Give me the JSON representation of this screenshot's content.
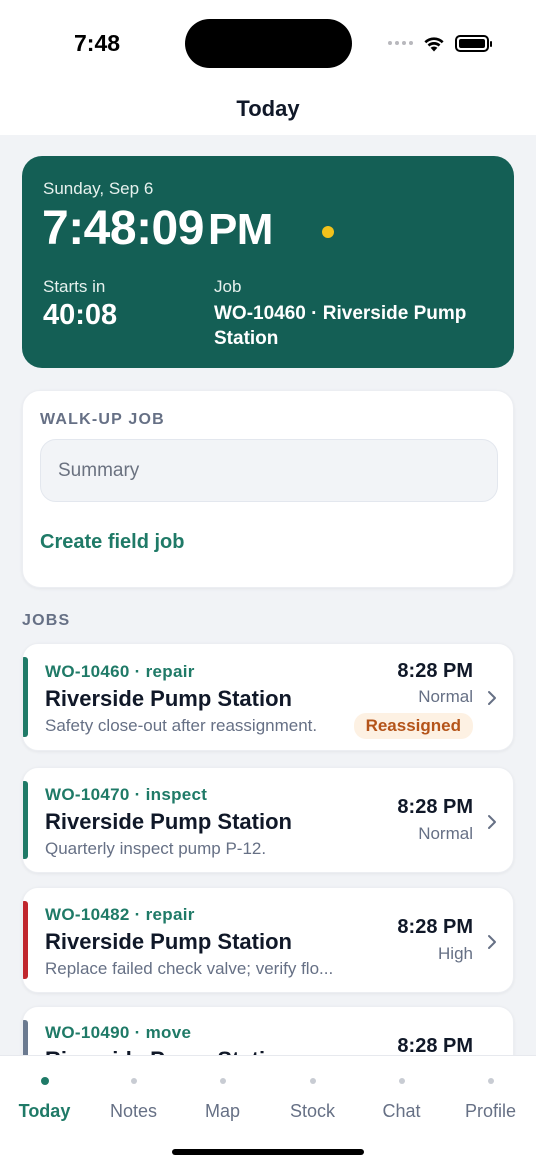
{
  "status_bar": {
    "time": "7:48"
  },
  "header": {
    "title": "Today"
  },
  "hero": {
    "date": "Sunday, Sep 6",
    "clock": "7:48:09",
    "ampm": "PM",
    "starts_label": "Starts in",
    "starts_value": "40:08",
    "job_label": "Job",
    "job_value": "WO-10460 · Riverside Pump Station",
    "colors": {
      "background": "#145f55",
      "live_dot": "#f2c21b"
    }
  },
  "walkup": {
    "label": "WALK-UP JOB",
    "summary_placeholder": "Summary",
    "summary_value": "",
    "create_label": "Create field job"
  },
  "jobs": {
    "label": "JOBS",
    "items": [
      {
        "code": "WO-10460 · repair",
        "title": "Riverside Pump Station",
        "description": "Safety close-out after reassignment.",
        "time": "8:28 PM",
        "priority": "Normal",
        "badge": "Reassigned",
        "stripe_color": "#1f7a67"
      },
      {
        "code": "WO-10470 · inspect",
        "title": "Riverside Pump Station",
        "description": "Quarterly inspect pump P-12.",
        "time": "8:28 PM",
        "priority": "Normal",
        "badge": "",
        "stripe_color": "#1f7a67"
      },
      {
        "code": "WO-10482 · repair",
        "title": "Riverside Pump Station",
        "description": "Replace failed check valve; verify flo...",
        "time": "8:28 PM",
        "priority": "High",
        "badge": "",
        "stripe_color": "#c0262d"
      },
      {
        "code": "WO-10490 · move",
        "title": "Riverside Pump Station",
        "description": "",
        "time": "8:28 PM",
        "priority": "",
        "badge": "",
        "stripe_color": "#6b7a90"
      }
    ]
  },
  "tabs": [
    {
      "label": "Today",
      "active": true
    },
    {
      "label": "Notes",
      "active": false
    },
    {
      "label": "Map",
      "active": false
    },
    {
      "label": "Stock",
      "active": false
    },
    {
      "label": "Chat",
      "active": false
    },
    {
      "label": "Profile",
      "active": false
    }
  ],
  "theme": {
    "accent": "#1f7a67"
  }
}
